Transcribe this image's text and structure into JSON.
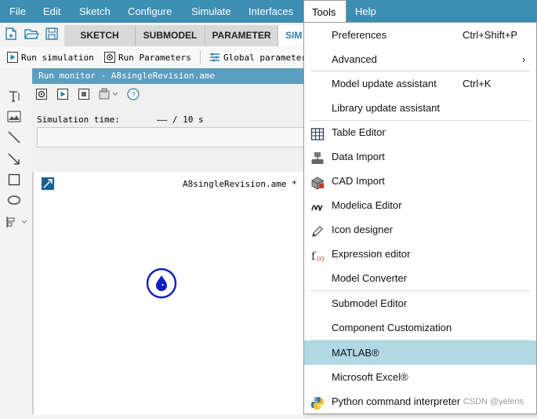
{
  "menubar": {
    "items": [
      "File",
      "Edit",
      "Sketch",
      "Configure",
      "Simulate",
      "Interfaces",
      "Tools",
      "Help"
    ]
  },
  "tabs": [
    "SKETCH",
    "SUBMODEL",
    "PARAMETER",
    "SIM"
  ],
  "actions": {
    "run_simulation": "Run simulation",
    "run_parameters": "Run Parameters",
    "global_parameters": "Global parameters"
  },
  "run_monitor": {
    "title": "Run monitor - A8singleRevision.ame",
    "sim_time_label": "Simulation time:",
    "sim_time_value": "—— / 10 s"
  },
  "canvas": {
    "filename": "A8singleRevision.ame *"
  },
  "tools_menu": {
    "items": [
      {
        "label": "Preferences",
        "shortcut": "Ctrl+Shift+P"
      },
      {
        "label": "Advanced",
        "shortcut": "›"
      },
      {
        "label": "Model update assistant",
        "shortcut": "Ctrl+K"
      },
      {
        "label": "Library update assistant",
        "shortcut": ""
      },
      {
        "label": "Table Editor",
        "shortcut": ""
      },
      {
        "label": "Data Import",
        "shortcut": ""
      },
      {
        "label": "CAD Import",
        "shortcut": ""
      },
      {
        "label": "Modelica Editor",
        "shortcut": ""
      },
      {
        "label": "Icon designer",
        "shortcut": ""
      },
      {
        "label": "Expression editor",
        "shortcut": ""
      },
      {
        "label": "Model Converter",
        "shortcut": ""
      },
      {
        "label": "Submodel Editor",
        "shortcut": ""
      },
      {
        "label": "Component Customization",
        "shortcut": ""
      },
      {
        "label": "MATLAB®",
        "shortcut": ""
      },
      {
        "label": "Microsoft Excel®",
        "shortcut": ""
      },
      {
        "label": "Python command interpreter",
        "shortcut": ""
      }
    ]
  },
  "watermark": "CSDN @yelens",
  "colors": {
    "menubar": "#3d8eb3",
    "highlight": "#b0d8e5",
    "accent": "#2d7fa8"
  }
}
